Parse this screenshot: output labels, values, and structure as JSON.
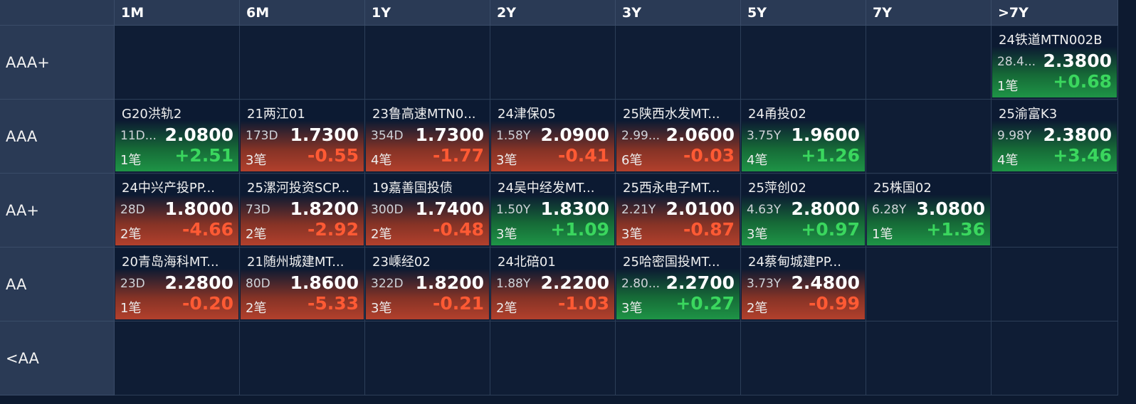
{
  "columns": [
    "1M",
    "6M",
    "1Y",
    "2Y",
    "3Y",
    "5Y",
    "7Y",
    ">7Y"
  ],
  "rows": [
    "AAA+",
    "AAA",
    "AA+",
    "AA",
    "<AA"
  ],
  "colors": {
    "up_text": "#3ad75e",
    "down_text": "#ff5a34",
    "up_bg": "#1e9446",
    "down_bg": "#b2402c",
    "header_bg": "#2a3a55",
    "grid_bg": "#0f1d35"
  },
  "cells": {
    "r0c7": {
      "name": "24铁道MTN002B",
      "term": "28.4...",
      "yield": "2.3800",
      "count": "1笔",
      "change": "+0.68",
      "dir": "up"
    },
    "r1c0": {
      "name": "G20洪轨2",
      "term": "11D...",
      "yield": "2.0800",
      "count": "1笔",
      "change": "+2.51",
      "dir": "up"
    },
    "r1c1": {
      "name": "21两江01",
      "term": "173D",
      "yield": "1.7300",
      "count": "3笔",
      "change": "-0.55",
      "dir": "down"
    },
    "r1c2": {
      "name": "23鲁高速MTN0...",
      "term": "354D",
      "yield": "1.7300",
      "count": "4笔",
      "change": "-1.77",
      "dir": "down"
    },
    "r1c3": {
      "name": "24津保05",
      "term": "1.58Y",
      "yield": "2.0900",
      "count": "3笔",
      "change": "-0.41",
      "dir": "down"
    },
    "r1c4": {
      "name": "25陕西水发MT...",
      "term": "2.99...",
      "yield": "2.0600",
      "count": "6笔",
      "change": "-0.03",
      "dir": "down"
    },
    "r1c5": {
      "name": "24甬投02",
      "term": "3.75Y",
      "yield": "1.9600",
      "count": "4笔",
      "change": "+1.26",
      "dir": "up"
    },
    "r1c7": {
      "name": "25渝富K3",
      "term": "9.98Y",
      "yield": "2.3800",
      "count": "4笔",
      "change": "+3.46",
      "dir": "up"
    },
    "r2c0": {
      "name": "24中兴产投PP...",
      "term": "28D",
      "yield": "1.8000",
      "count": "2笔",
      "change": "-4.66",
      "dir": "down"
    },
    "r2c1": {
      "name": "25漯河投资SCP...",
      "term": "73D",
      "yield": "1.8200",
      "count": "2笔",
      "change": "-2.92",
      "dir": "down"
    },
    "r2c2": {
      "name": "19嘉善国投债",
      "term": "300D",
      "yield": "1.7400",
      "count": "2笔",
      "change": "-0.48",
      "dir": "down"
    },
    "r2c3": {
      "name": "24吴中经发MT...",
      "term": "1.50Y",
      "yield": "1.8300",
      "count": "3笔",
      "change": "+1.09",
      "dir": "up"
    },
    "r2c4": {
      "name": "25西永电子MT...",
      "term": "2.21Y",
      "yield": "2.0100",
      "count": "3笔",
      "change": "-0.87",
      "dir": "down"
    },
    "r2c5": {
      "name": "25萍创02",
      "term": "4.63Y",
      "yield": "2.8000",
      "count": "3笔",
      "change": "+0.97",
      "dir": "up"
    },
    "r2c6": {
      "name": "25株国02",
      "term": "6.28Y",
      "yield": "3.0800",
      "count": "1笔",
      "change": "+1.36",
      "dir": "up"
    },
    "r3c0": {
      "name": "20青岛海科MT...",
      "term": "23D",
      "yield": "2.2800",
      "count": "1笔",
      "change": "-0.20",
      "dir": "down"
    },
    "r3c1": {
      "name": "21随州城建MT...",
      "term": "80D",
      "yield": "1.8600",
      "count": "2笔",
      "change": "-5.33",
      "dir": "down"
    },
    "r3c2": {
      "name": "23嵊经02",
      "term": "322D",
      "yield": "1.8200",
      "count": "3笔",
      "change": "-0.21",
      "dir": "down"
    },
    "r3c3": {
      "name": "24北碚01",
      "term": "1.88Y",
      "yield": "2.2200",
      "count": "2笔",
      "change": "-1.03",
      "dir": "down"
    },
    "r3c4": {
      "name": "25哈密国投MT...",
      "term": "2.80...",
      "yield": "2.2700",
      "count": "3笔",
      "change": "+0.27",
      "dir": "up"
    },
    "r3c5": {
      "name": "24蔡甸城建PP...",
      "term": "3.73Y",
      "yield": "2.4800",
      "count": "2笔",
      "change": "-0.99",
      "dir": "down"
    }
  }
}
